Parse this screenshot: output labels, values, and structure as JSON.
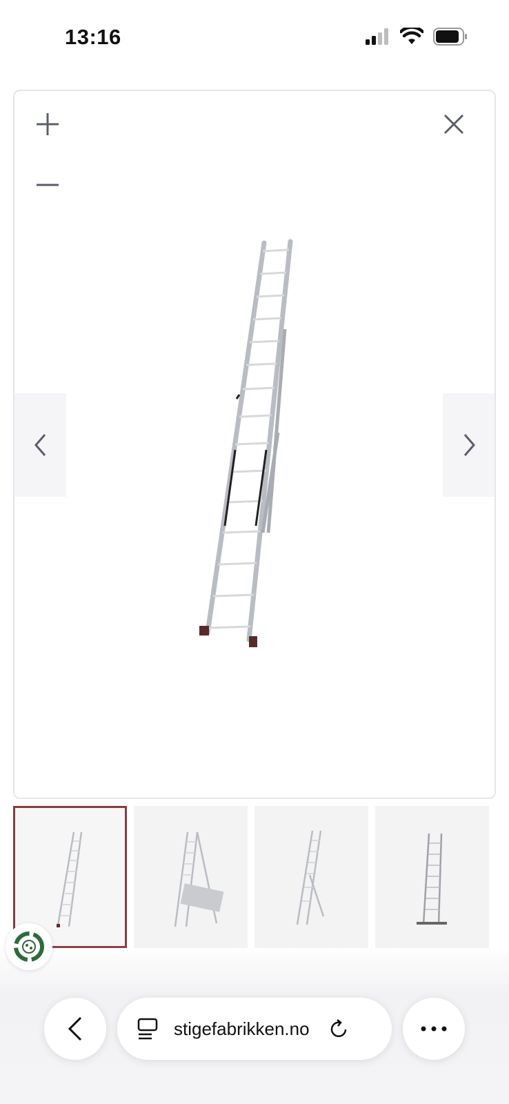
{
  "status": {
    "time": "13:16",
    "signal_icon": "cellular-signal-icon",
    "wifi_icon": "wifi-icon",
    "battery_icon": "battery-icon"
  },
  "viewer": {
    "zoom_in_icon": "plus-icon",
    "zoom_out_icon": "minus-icon",
    "close_icon": "close-icon",
    "prev_icon": "chevron-left-icon",
    "next_icon": "chevron-right-icon",
    "image_subject": "extension ladder"
  },
  "thumbnails": [
    {
      "subject": "ladder leaning",
      "selected": true
    },
    {
      "subject": "ladder with box",
      "selected": false
    },
    {
      "subject": "ladder a-frame",
      "selected": false
    },
    {
      "subject": "ladder upright",
      "selected": false
    }
  ],
  "colors": {
    "selected_thumb_border": "#8a3a3a",
    "badge_green": "#2e6b3a"
  },
  "browser": {
    "back_icon": "chevron-left-icon",
    "tabs_icon": "reader-icon",
    "url": "stigefabrikken.no",
    "reload_icon": "reload-icon",
    "more_icon": "more-icon"
  }
}
